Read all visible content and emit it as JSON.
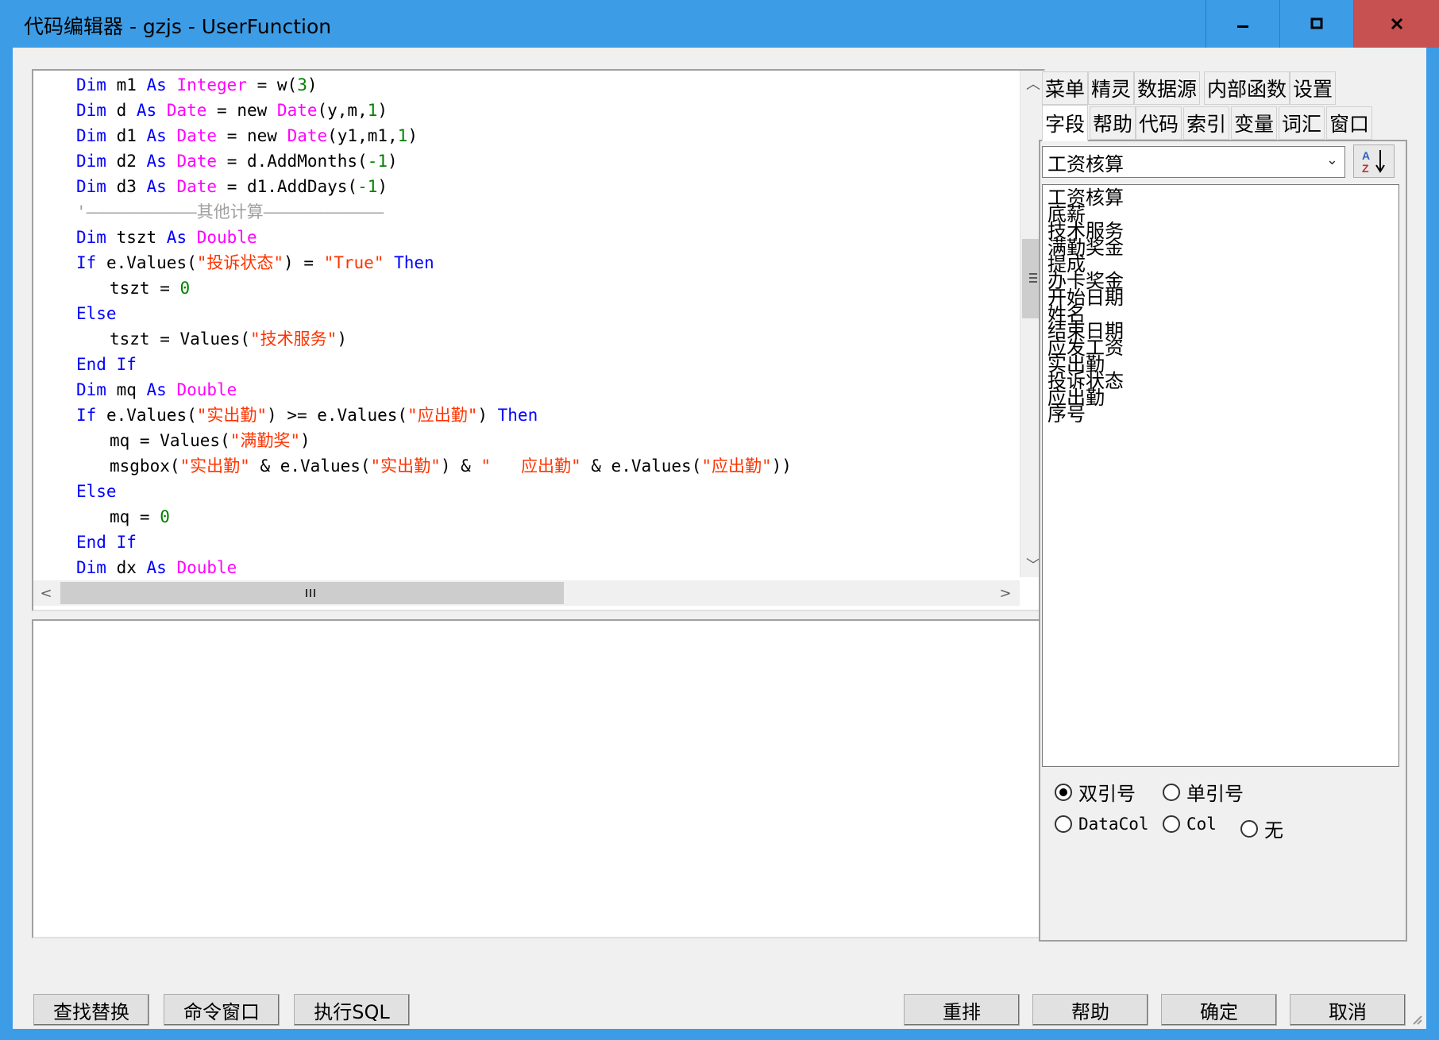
{
  "window": {
    "title": "代码编辑器 - gzjs - UserFunction"
  },
  "code_lines": [
    {
      "indent": 4,
      "segs": [
        [
          "kw",
          "Dim"
        ],
        [
          "t",
          " m1 "
        ],
        [
          "kw",
          "As"
        ],
        [
          "t",
          " "
        ],
        [
          "ty",
          "Integer"
        ],
        [
          "t",
          " = w("
        ],
        [
          "num",
          "3"
        ],
        [
          "t",
          ")"
        ]
      ]
    },
    {
      "indent": 4,
      "segs": [
        [
          "kw",
          "Dim"
        ],
        [
          "t",
          " d "
        ],
        [
          "kw",
          "As"
        ],
        [
          "t",
          " "
        ],
        [
          "ty",
          "Date"
        ],
        [
          "t",
          " = new "
        ],
        [
          "ty",
          "Date"
        ],
        [
          "t",
          "(y,m,"
        ],
        [
          "num",
          "1"
        ],
        [
          "t",
          ")"
        ]
      ]
    },
    {
      "indent": 4,
      "segs": [
        [
          "kw",
          "Dim"
        ],
        [
          "t",
          " d1 "
        ],
        [
          "kw",
          "As"
        ],
        [
          "t",
          " "
        ],
        [
          "ty",
          "Date"
        ],
        [
          "t",
          " = new "
        ],
        [
          "ty",
          "Date"
        ],
        [
          "t",
          "(y1,m1,"
        ],
        [
          "num",
          "1"
        ],
        [
          "t",
          ")"
        ]
      ]
    },
    {
      "indent": 4,
      "segs": [
        [
          "kw",
          "Dim"
        ],
        [
          "t",
          " d2 "
        ],
        [
          "kw",
          "As"
        ],
        [
          "t",
          " "
        ],
        [
          "ty",
          "Date"
        ],
        [
          "t",
          " = d.AddMonths("
        ],
        [
          "num",
          "-1"
        ],
        [
          "t",
          ")"
        ]
      ]
    },
    {
      "indent": 4,
      "segs": [
        [
          "kw",
          "Dim"
        ],
        [
          "t",
          " d3 "
        ],
        [
          "kw",
          "As"
        ],
        [
          "t",
          " "
        ],
        [
          "ty",
          "Date"
        ],
        [
          "t",
          " = d1.AddDays("
        ],
        [
          "num",
          "-1"
        ],
        [
          "t",
          ")"
        ]
      ]
    },
    {
      "indent": 4,
      "segs": [
        [
          "cmt",
          "'———————————其他计算————————————"
        ]
      ]
    },
    {
      "indent": 4,
      "segs": [
        [
          "kw",
          "Dim"
        ],
        [
          "t",
          " tszt "
        ],
        [
          "kw",
          "As"
        ],
        [
          "t",
          " "
        ],
        [
          "ty",
          "Double"
        ]
      ]
    },
    {
      "indent": 4,
      "segs": [
        [
          "kw",
          "If"
        ],
        [
          "t",
          " e.Values("
        ],
        [
          "str",
          "\"投诉状态\""
        ],
        [
          "t",
          ") = "
        ],
        [
          "str",
          "\"True\""
        ],
        [
          "t",
          " "
        ],
        [
          "kw",
          "Then"
        ]
      ]
    },
    {
      "indent": 8,
      "segs": [
        [
          "t",
          "tszt = "
        ],
        [
          "num",
          "0"
        ]
      ]
    },
    {
      "indent": 4,
      "segs": [
        [
          "kw",
          "Else"
        ]
      ]
    },
    {
      "indent": 8,
      "segs": [
        [
          "t",
          "tszt = Values("
        ],
        [
          "str",
          "\"技术服务\""
        ],
        [
          "t",
          ")"
        ]
      ]
    },
    {
      "indent": 4,
      "segs": [
        [
          "kw",
          "End If"
        ]
      ]
    },
    {
      "indent": 4,
      "segs": [
        [
          "kw",
          "Dim"
        ],
        [
          "t",
          " mq "
        ],
        [
          "kw",
          "As"
        ],
        [
          "t",
          " "
        ],
        [
          "ty",
          "Double"
        ]
      ]
    },
    {
      "indent": 4,
      "segs": [
        [
          "kw",
          "If"
        ],
        [
          "t",
          " e.Values("
        ],
        [
          "str",
          "\"实出勤\""
        ],
        [
          "t",
          ") >= e.Values("
        ],
        [
          "str",
          "\"应出勤\""
        ],
        [
          "t",
          ") "
        ],
        [
          "kw",
          "Then"
        ]
      ]
    },
    {
      "indent": 8,
      "segs": [
        [
          "t",
          "mq = Values("
        ],
        [
          "str",
          "\"满勤奖\""
        ],
        [
          "t",
          ")"
        ]
      ]
    },
    {
      "indent": 8,
      "segs": [
        [
          "t",
          "msgbox("
        ],
        [
          "str",
          "\"实出勤\""
        ],
        [
          "t",
          " & e.Values("
        ],
        [
          "str",
          "\"实出勤\""
        ],
        [
          "t",
          ") & "
        ],
        [
          "str",
          "\"   应出勤\""
        ],
        [
          "t",
          " & e.Values("
        ],
        [
          "str",
          "\"应出勤\""
        ],
        [
          "t",
          "))"
        ]
      ]
    },
    {
      "indent": 4,
      "segs": [
        [
          "kw",
          "Else"
        ]
      ]
    },
    {
      "indent": 8,
      "segs": [
        [
          "t",
          "mq = "
        ],
        [
          "num",
          "0"
        ]
      ]
    },
    {
      "indent": 4,
      "segs": [
        [
          "kw",
          "End If"
        ]
      ]
    },
    {
      "indent": 4,
      "segs": [
        [
          "kw",
          "Dim"
        ],
        [
          "t",
          " dx "
        ],
        [
          "kw",
          "As"
        ],
        [
          "t",
          " "
        ],
        [
          "ty",
          "Double"
        ]
      ]
    }
  ],
  "bottom_buttons": {
    "find_replace": "查找替换",
    "command_window": "命令窗口",
    "execute_sql": "执行SQL",
    "rearrange": "重排",
    "help": "帮助",
    "ok": "确定",
    "cancel": "取消"
  },
  "tabs_row1": [
    "菜单",
    "精灵",
    "数据源",
    "内部函数",
    "设置"
  ],
  "tabs_row2": [
    "字段",
    "帮助",
    "代码",
    "索引",
    "变量",
    "词汇",
    "窗口"
  ],
  "table_select": {
    "value": "工资核算"
  },
  "fields": [
    "工资核算",
    "底薪",
    "技术服务",
    "满勤奖金",
    "提成",
    "办卡奖金",
    "开始日期",
    "姓名",
    "结束日期",
    "应发工资",
    "实出勤",
    "投诉状态",
    "应出勤",
    "序号"
  ],
  "quote_options": {
    "double": "双引号",
    "single": "单引号",
    "datacol": "DataCol",
    "col": "Col",
    "none": "无",
    "selected": "double"
  },
  "colors": {
    "keyword": "#0000ff",
    "type": "#ff00ff",
    "string": "#ff3300",
    "number": "#008000",
    "comment": "#a0a0a0",
    "titlebar": "#3c9de6",
    "close": "#c75050"
  }
}
